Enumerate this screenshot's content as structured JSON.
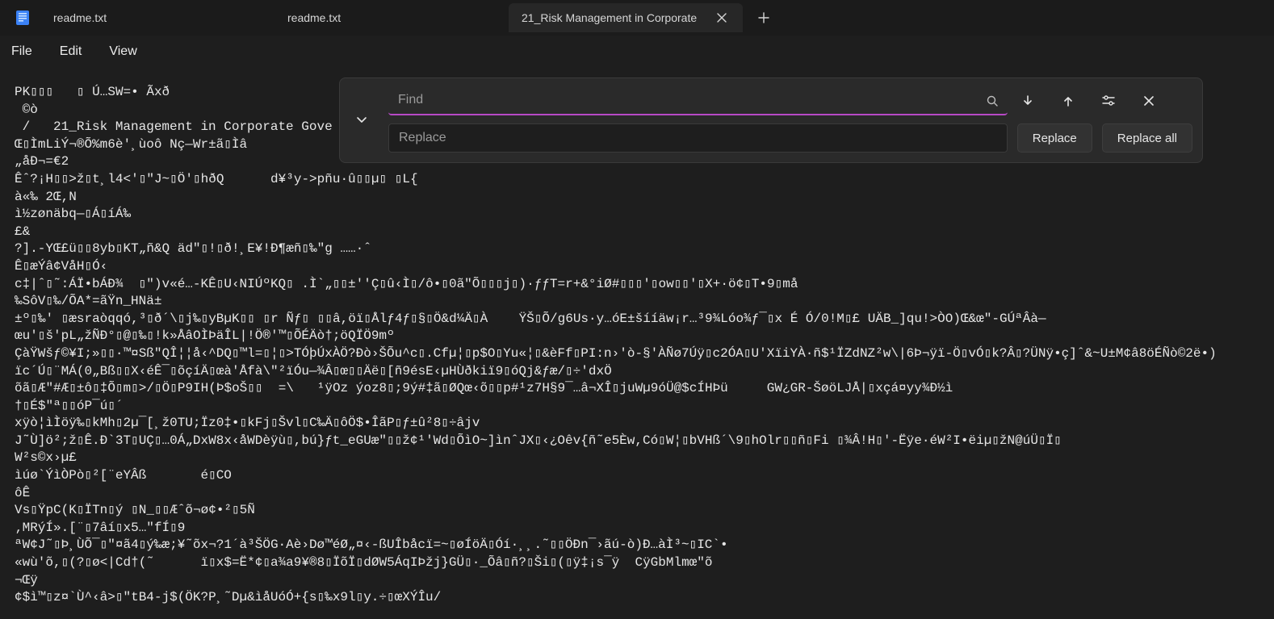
{
  "tabs": [
    {
      "label": "readme.txt",
      "active": false,
      "closeable": false
    },
    {
      "label": "readme.txt",
      "active": false,
      "closeable": false
    },
    {
      "label": "21_Risk Management in Corporate",
      "active": true,
      "closeable": true
    }
  ],
  "menu": {
    "file": "File",
    "edit": "Edit",
    "view": "View"
  },
  "find_replace": {
    "find_placeholder": "Find",
    "find_value": "",
    "replace_placeholder": "Replace",
    "replace_value": "",
    "replace_btn": "Replace",
    "replace_all_btn": "Replace all",
    "expanded": true
  },
  "document_text": "PK▯▯▯   ▯ Ú…SW=• Ãxð\n ©ò\n /   21_Risk Management in Corporate Gove\nŒ▯ÌmLiÝ¬®Õ%m6è'¸ùoô Nç—Wr±ã▯Ìâ\n„åÐ¬=€2\nÊˆ?¡H▯▯>ž▯t¸l4<'▯\"J~▯Ö'▯hðQ      d¥³y->pñu·û▯▯µ▯ ▯L{\nà«‰ 2Œ,N\nì½zønäbq—▯Á▯íÁ‰\n£&\n?].-YŒ£ü▯▯8yb▯KT„ñ&Q äd\"▯!▯ð!¸E¥!Ð¶æñ▯‰\"g ……·ˆ\nÊ▯æÝâ¢VåH▯Ó‹\nc‡|ˆ▯˜:ÁÏ•bÁÐ¾  ▯\")v«é…-KÊ▯U‹NIÚºKQ▯ .Ì`„▯▯±''Ç▯û‹Ì▯/ô•▯0ã\"Õ▯▯▯j▯)·ƒƒT=r+&°iØ#▯▯▯'▯ow▯▯'▯X+·ö¢▯T•9▯må\n‰SôV▯‰/ÕA*=ãŸn_HNä±\n±º▯‰' ▯æsraòqqó,³▯ð´\\▯j‰▯yBµK▯▯ ▯r Ñƒ▯ ▯▯â,öï▯Ålƒ4ƒ▯§▯Ö&d¼Ä▯À    ŸŠ▯Õ/g6Us·y…óE±šííäw¡r…³9¾Lóo¾ƒ¯▯x É Ó/0!M▯£ UÄB_]qu!>ÒO)Œ&œ\"-GÚªÂà—\nœu'▯š'pL„žÑÐ°▯@▯‰▯!k»ÅâOÌÞäÎL|!Ö®'™▯ÕÉÄò†;öQÏÖ9mº\nÇàŸWšƒ©¥I;»▯▯·™¤Sß\"QÎ¦¦å‹^DQ▯™l=▯¦▯>TÓþÚxÀÖ?Ðò›ŠÕu^c▯.Cfµ¦▯p$O▯Yu«¦▯&èFf▯PI:n›'ò-§'ÀÑø7Úÿ▯c2ÓA▯U'XïiYÀ·ñ$¹ÏZdNZ²w\\|6Þ¬ÿï-Ö▯vÓ▯k?Â▯?ÜNÿ•ç]ˆ&~U±M¢â8öÉÑò©2ë•)\nïc´Ú▯¨MÁ(0„Bß▯▯X‹éÊ¯▯õçíÄ▯œà'Åfà\\\"²ïÓu—¾Â▯œ▯▯Äë▯[ñ9ésE‹µHÙðkiï9▯óQj&ƒæ/▯÷'dxÖ\nõã▯Æ\"#Æ▯±ô▯‡Õ▯m▯>/▯Ö▯P9IH(Þ$oŠ▯▯  =\\   ¹ÿOz ýoz8▯;9ý#‡ã▯ØQœ‹õ▯▯p#¹z7H§9¯…â¬XÎ▯juWµ9óÜ@$cÍHÞü     GW¿GR-ŠøöLJÅ|▯xçá¤yy¾Ð½ì\n†▯É$\"ª▯▯óP¯ú▯´\nxÿò¦ìÌöÿ‰▯kMh▯2µ¯[¸ž0TU;Ïz0‡•▯kFj▯Švl▯C‰Ä▯ôÖ$•ÎãP▯ƒ±û²8▯÷âjv\nJ˜Ù]ö²;ž▯Ê.Ð`3T▯UÇ▯…0Á„DxW8x‹åWDèÿù▯,bú}ƒt_eGUæ\"▯▯ž¢¹'Wd▯ÕìO~]ìnˆJX▯‹¿Oêv{ñ˜e5Èw,Có▯W¦▯bVHß´\\9▯hOlr▯▯ñ▯Fi ▯¾Â!H▯'-Ëÿe·éW²I•ëiµ▯žN@úÜ▯Ï▯\nW²s©x›µ£\nìúø`ÝìÒPò▯²[¨eYÂß       é▯CO\nôÊ\nVs▯ŸpC(K▯ÏTn▯ý ▯N_▯▯Æˆõ¬ø¢•²▯5Ñ\n‚MRýÍ».[¨▯7âí▯x5…\"fÍ▯9\nªW¢J˜▯Þ¸ÙÕ¯▯\"¤ã4▯ý‰æ;¥˜õx¬?1´à³ŠÖG·Aè›Dø™éØ„¤‹-ßUÎbåcï=~▯øÍöÄ▯Óí·¸¸.˜▯▯ÖÐn¯›ãú-ò)Ð…àÌ³~▯IC`•\n«wù'õ,▯(?▯ø<|Cd†(˜      ï▯x$=Ë*¢▯a¾a9¥®8▯ÏõÏ▯dØW5ÁqIÞžj}GÜ▯·_Õâ▯ñ?▯Ši▯(▯ÿ‡¡s¯ÿ  CÿGbMlmœ\"õ\n¬Œÿ\n¢$ì™▯z¤`Ù^‹â>▯\"tB4-j$(ÖK?P¸˜Dµ&ìåUóÓ+{s▯‰x9l▯y.÷▯œXÝÎu/"
}
